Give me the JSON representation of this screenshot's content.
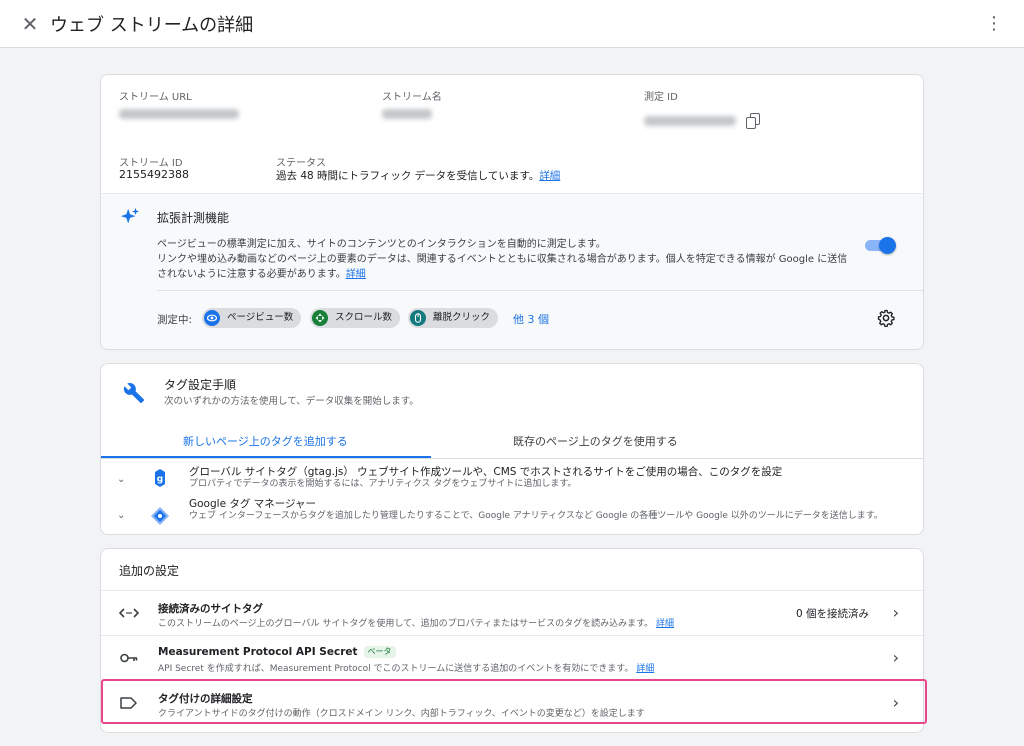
{
  "header": {
    "close_glyph": "✕",
    "title": "ウェブ ストリームの詳細",
    "more_glyph": "⋮"
  },
  "stream": {
    "url_label": "ストリーム URL",
    "name_label": "ストリーム名",
    "measurement_id_label": "測定 ID",
    "stream_id_label": "ストリーム ID",
    "stream_id_value": "2155492388",
    "status_label": "ステータス",
    "status_text": "過去 48 時間にトラフィック データを受信しています。",
    "status_link": "詳細"
  },
  "enhanced": {
    "title": "拡張計測機能",
    "desc": "ページビューの標準測定に加え、サイトのコンテンツとのインタラクションを自動的に測定します。\nリンクや埋め込み動画などのページ上の要素のデータは、関連するイベントとともに収集される場合があります。個人を特定できる情報が Google に送信されないように注意する必要があります。",
    "desc_link": "詳細",
    "toggle_on": true,
    "measuring_label": "測定中:",
    "chips": [
      {
        "label": "ページビュー数",
        "icon": "eye-icon",
        "color": "#1a73e8"
      },
      {
        "label": "スクロール数",
        "icon": "scroll-icon",
        "color": "#188038"
      },
      {
        "label": "離脱クリック",
        "icon": "mouse-icon",
        "color": "#137a7f"
      }
    ],
    "more_link": "他 3 個"
  },
  "tagging": {
    "title": "タグ設定手順",
    "subtitle": "次のいずれかの方法を使用して、データ収集を開始します。",
    "tabs": [
      "新しいページ上のタグを追加する",
      "既存のページ上のタグを使用する"
    ],
    "rows": [
      {
        "title": "グローバル サイトタグ（gtag.js） ウェブサイト作成ツールや、CMS でホストされるサイトをご使用の場合、このタグを設定",
        "desc": "プロパティでデータの表示を開始するには、アナリティクス タグをウェブサイトに追加します。",
        "icon": "gtag-icon"
      },
      {
        "title": "Google タグ マネージャー",
        "desc": "ウェブ インターフェースからタグを追加したり管理したりすることで、Google アナリティクスなど Google の各種ツールや Google 以外のツールにデータを送信します。",
        "icon": "gtm-icon"
      }
    ]
  },
  "additional": {
    "title": "追加の設定",
    "rows": [
      {
        "title": "接続済みのサイトタグ",
        "desc": "このストリームのページ上のグローバル サイトタグを使用して、追加のプロパティまたはサービスのタグを読み込みます。",
        "link": "詳細",
        "right": "0 個を接続済み",
        "icon": "code-icon"
      },
      {
        "title": "Measurement Protocol API Secret",
        "badge": "ベータ",
        "desc": "API Secret を作成すれば、Measurement Protocol でこのストリームに送信する追加のイベントを有効にできます。",
        "link": "詳細",
        "icon": "key-icon"
      },
      {
        "title": "タグ付けの詳細設定",
        "desc": "クライアントサイドのタグ付けの動作（クロスドメイン リンク、内部トラフィック、イベントの変更など）を設定します",
        "icon": "label-icon"
      }
    ],
    "arrow_glyph": "›"
  },
  "colors": {
    "accent": "#1a73e8",
    "highlight": "#e8478b"
  }
}
